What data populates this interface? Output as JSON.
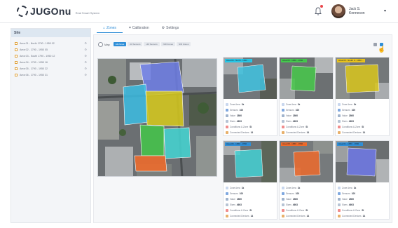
{
  "header": {
    "logo_text": "JUGOnu",
    "logo_sub": "Real Smart System",
    "user_name": "Jack S. Kenneson",
    "caret": "▾"
  },
  "sidebar": {
    "title": "Site",
    "items": [
      {
        "label": "Area 01 - North 1790 - 1950 02"
      },
      {
        "label": "Area 02 - 1790 - 1950 05"
      },
      {
        "label": "Area 03 - South 1790 - 1950 12"
      },
      {
        "label": "Area 04 - 1790 - 1950 16"
      },
      {
        "label": "Area 05 - 1790 - 1950 22"
      },
      {
        "label": "Area 06 - 1790 - 1950 31"
      }
    ]
  },
  "tabs": [
    {
      "label": "Zones",
      "icon": "zones-icon",
      "active": true
    },
    {
      "label": "Calibration",
      "icon": "calibration-icon",
      "active": false
    },
    {
      "label": "Settings",
      "icon": "settings-icon",
      "active": false
    }
  ],
  "toolbar": {
    "map_label": "Map",
    "chips": [
      "All Zones",
      "All Sensors",
      "HD Sensors",
      "NIR Zones",
      "NIR Zones"
    ]
  },
  "cards": [
    {
      "title": "Area 04 - North - 1950 - ...",
      "title_color": "#27c6e6",
      "zone_color": "#3fc3e0",
      "metrics": [
        {
          "label": "Zone Area",
          "value": "1k"
        },
        {
          "label": "Sensors",
          "value": "100"
        },
        {
          "label": "Value",
          "value": "2800"
        },
        {
          "label": "Sizes",
          "value": "4603"
        },
        {
          "label": "Conditions & Zone",
          "value": "SI"
        },
        {
          "label": "Connected Devices",
          "value": "14"
        }
      ]
    },
    {
      "title": "Area 05 - 1950 - 1950 ...",
      "title_color": "#45c84d",
      "zone_color": "#47c84a",
      "metrics": [
        {
          "label": "Zone Area",
          "value": "1k"
        },
        {
          "label": "Sensors",
          "value": "100"
        },
        {
          "label": "Value",
          "value": "2800"
        },
        {
          "label": "Sizes",
          "value": "4603"
        },
        {
          "label": "Conditions & Zone",
          "value": "SI"
        },
        {
          "label": "Connected Devices",
          "value": "14"
        }
      ]
    },
    {
      "title": "Area 02 - South 2 - 1950 ...",
      "title_color": "#e8c21d",
      "zone_color": "#d9c51c",
      "metrics": [
        {
          "label": "Zone Area",
          "value": "1k"
        },
        {
          "label": "Sensors",
          "value": "100"
        },
        {
          "label": "Value",
          "value": "2800"
        },
        {
          "label": "Sizes",
          "value": "4603"
        },
        {
          "label": "Conditions & Zone",
          "value": "SI"
        },
        {
          "label": "Connected Devices",
          "value": "14"
        }
      ]
    },
    {
      "title": "Area 06 - 1950 - 1950 ...",
      "title_color": "#2f8fd8",
      "zone_color": "#43d0d3",
      "metrics": [
        {
          "label": "Zone Area",
          "value": "1k"
        },
        {
          "label": "Sensors",
          "value": "100"
        },
        {
          "label": "Value",
          "value": "2800"
        },
        {
          "label": "Sizes",
          "value": "4603"
        },
        {
          "label": "Conditions & Zone",
          "value": "SI"
        },
        {
          "label": "Connected Devices",
          "value": "14"
        }
      ]
    },
    {
      "title": "Area 08 - 1950 - 1950 ...",
      "title_color": "#f06a2a",
      "zone_color": "#ea6a2e",
      "metrics": [
        {
          "label": "Zone Area",
          "value": "1k"
        },
        {
          "label": "Sensors",
          "value": "100"
        },
        {
          "label": "Value",
          "value": "2800"
        },
        {
          "label": "Sizes",
          "value": "4603"
        },
        {
          "label": "Conditions & Zone",
          "value": "SI"
        },
        {
          "label": "Connected Devices",
          "value": "14"
        }
      ]
    },
    {
      "title": "Area 01 - 1950 - 1950 ...",
      "title_color": "#2f8fd8",
      "zone_color": "#6f79e8",
      "metrics": [
        {
          "label": "Zone Area",
          "value": "1k"
        },
        {
          "label": "Sensors",
          "value": "100"
        },
        {
          "label": "Value",
          "value": "2800"
        },
        {
          "label": "Sizes",
          "value": "4603"
        },
        {
          "label": "Conditions & Zone",
          "value": "SI"
        },
        {
          "label": "Connected Devices",
          "value": "14"
        }
      ]
    }
  ],
  "metric_icon_colors": [
    "#c9d7ee",
    "#7fa8e0",
    "#a0b3cc",
    "#b6c3d4",
    "#f08c8c",
    "#e8b06a"
  ],
  "map_zone_colors": {
    "purple": "#6e7fe6",
    "cyan": "#3bbde3",
    "yellow": "#d4c71e",
    "green": "#44c44a",
    "teal": "#44d4d0",
    "orange": "#ec6a2c"
  }
}
